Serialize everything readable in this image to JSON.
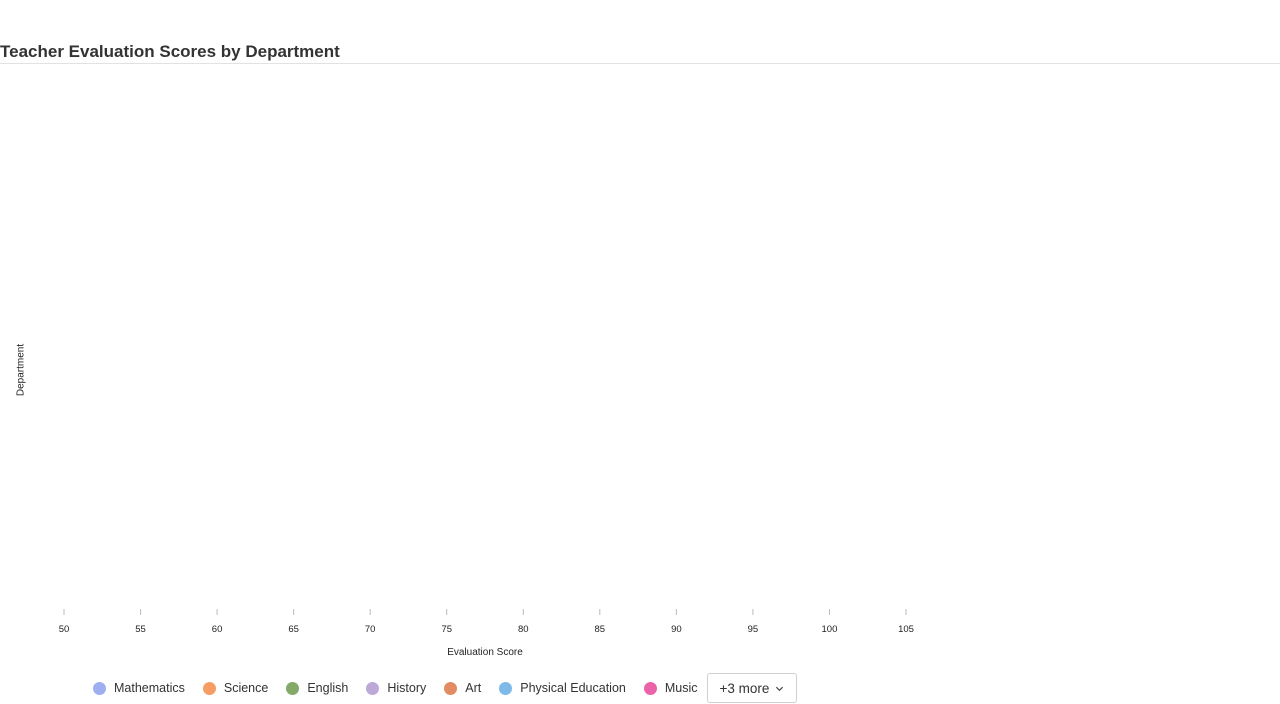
{
  "chart_data": {
    "type": "scatter",
    "title": "Teacher Evaluation Scores by Department",
    "xlabel": "Evaluation Score",
    "ylabel": "Department",
    "xlim": [
      50,
      105
    ],
    "x_ticks": [
      "50",
      "55",
      "60",
      "65",
      "70",
      "75",
      "80",
      "85",
      "90",
      "95",
      "100",
      "105"
    ],
    "series": [
      {
        "name": "Mathematics",
        "color": "#8da0ee"
      },
      {
        "name": "Science",
        "color": "#f58c48"
      },
      {
        "name": "English",
        "color": "#6e9a4e"
      },
      {
        "name": "History",
        "color": "#b29ad0"
      },
      {
        "name": "Art",
        "color": "#de7848"
      },
      {
        "name": "Physical Education",
        "color": "#66aee6"
      },
      {
        "name": "Music",
        "color": "#e8469a"
      }
    ],
    "legend_position": "bottom",
    "grid": false
  },
  "legend": {
    "more_label": "+3 more"
  }
}
